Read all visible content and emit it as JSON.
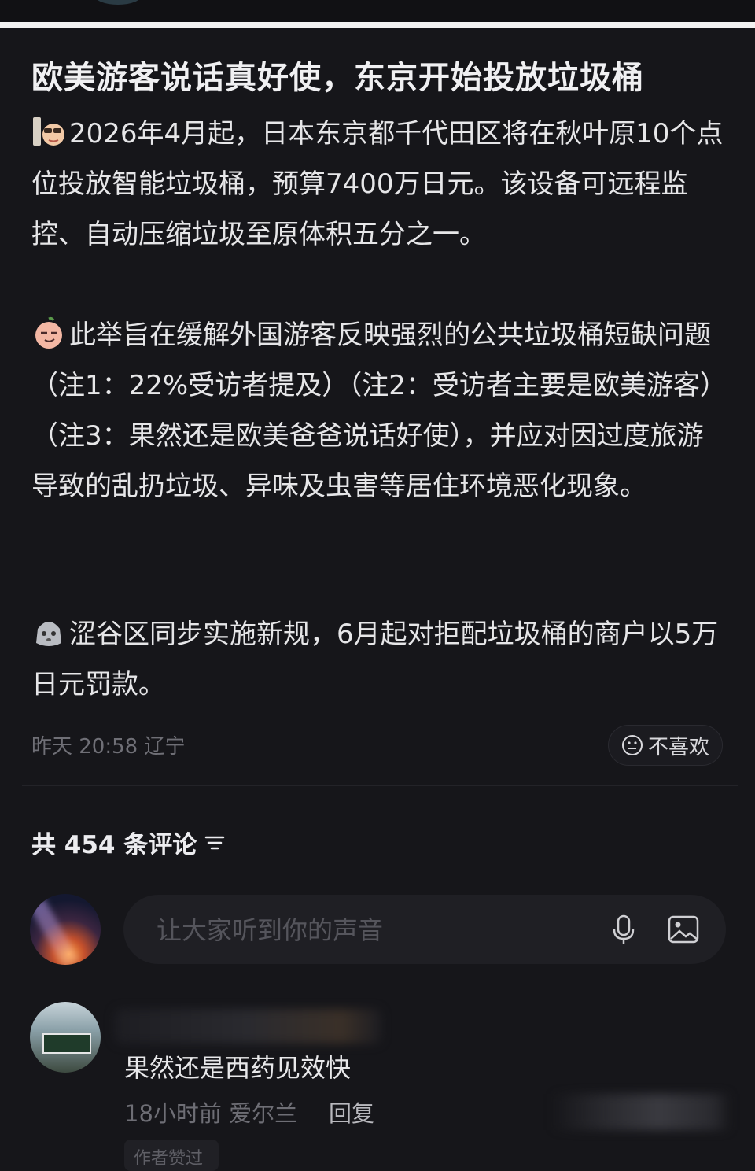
{
  "post": {
    "title": "欧美游客说话真好使，东京开始投放垃圾桶",
    "paragraphs": [
      {
        "emoji_icon": "reading-face-icon",
        "text": "2026年4月起，日本东京都千代田区将在秋叶原10个点位投放智能垃圾桶，预算7400万日元。该设备可远程监控、自动压缩垃圾至原体积五分之一。"
      },
      {
        "emoji_icon": "peach-smirk-face-icon",
        "text": "此举旨在缓解外国游客反映强烈的公共垃圾桶短缺问题（注1：22%受访者提及）（注2：受访者主要是欧美游客）（注3：果然还是欧美爸爸说话好使），并应对因过度旅游导致的乱扔垃圾、异味及虫害等居住环境恶化现象。"
      },
      {
        "emoji_icon": "gray-face-icon",
        "text": "涩谷区同步实施新规，6月起对拒配垃圾桶的商户以5万日元罚款。"
      }
    ],
    "meta": "昨天 20:58 辽宁",
    "dislike_label": "不喜欢"
  },
  "comments": {
    "count_label": "共 454 条评论",
    "input_placeholder": "让大家听到你的声音",
    "items": [
      {
        "text": "果然还是西药见效快",
        "meta": "18小时前 爱尔兰",
        "reply_label": "回复",
        "tag": "作者赞过"
      }
    ]
  },
  "colors": {
    "background": "#16161a",
    "text": "#e8e8ea",
    "muted": "#6f6f76"
  }
}
